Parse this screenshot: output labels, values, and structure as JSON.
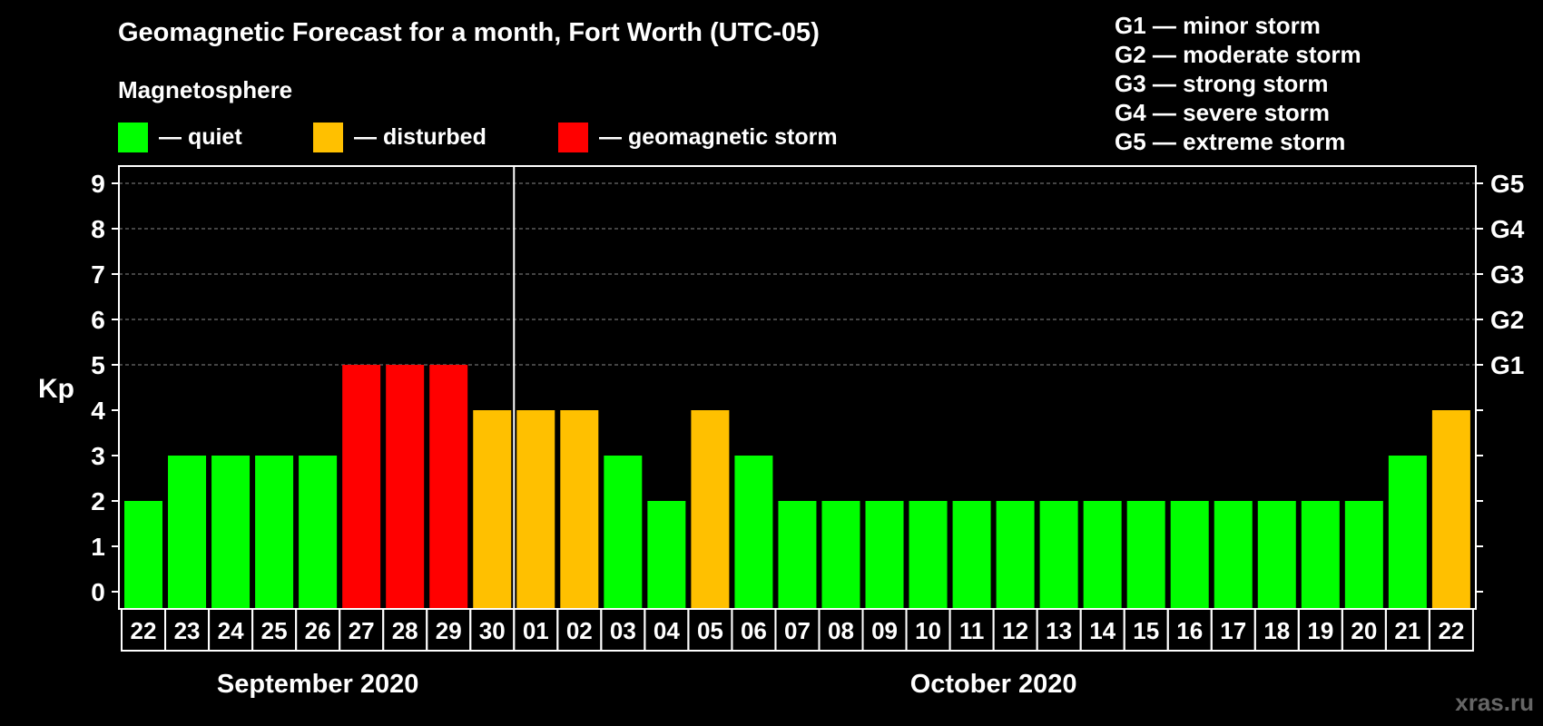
{
  "title": "Geomagnetic Forecast for a month, Fort Worth (UTC-05)",
  "subtitle": "Magnetosphere",
  "legend": [
    {
      "label": "— quiet",
      "color": "#00ff00"
    },
    {
      "label": "— disturbed",
      "color": "#ffc000"
    },
    {
      "label": "— geomagnetic storm",
      "color": "#ff0000"
    }
  ],
  "storm_legend": [
    "G1 — minor storm",
    "G2 — moderate storm",
    "G3 — strong storm",
    "G4 — severe storm",
    "G5 — extreme storm"
  ],
  "watermark": "xras.ru",
  "chart_data": {
    "type": "bar",
    "ylabel": "Kp",
    "ylim": [
      0,
      9
    ],
    "yticks": [
      0,
      1,
      2,
      3,
      4,
      5,
      6,
      7,
      8,
      9
    ],
    "right_axis_labels": [
      {
        "kp": 5,
        "label": "G1"
      },
      {
        "kp": 6,
        "label": "G2"
      },
      {
        "kp": 7,
        "label": "G3"
      },
      {
        "kp": 8,
        "label": "G4"
      },
      {
        "kp": 9,
        "label": "G5"
      }
    ],
    "grid": "dashed horizontal lines at Kp 5–9",
    "categories": [
      "22",
      "23",
      "24",
      "25",
      "26",
      "27",
      "28",
      "29",
      "30",
      "01",
      "02",
      "03",
      "04",
      "05",
      "06",
      "07",
      "08",
      "09",
      "10",
      "11",
      "12",
      "13",
      "14",
      "15",
      "16",
      "17",
      "18",
      "19",
      "20",
      "21",
      "22"
    ],
    "values": [
      2,
      3,
      3,
      3,
      3,
      5,
      5,
      5,
      4,
      4,
      4,
      3,
      2,
      4,
      3,
      2,
      2,
      2,
      2,
      2,
      2,
      2,
      2,
      2,
      2,
      2,
      2,
      2,
      2,
      3,
      4
    ],
    "color_rule": {
      "quiet": "#00ff00",
      "disturbed": "#ffc000",
      "storm": "#ff0000"
    },
    "month_groups": [
      {
        "label": "September 2020",
        "count": 9
      },
      {
        "label": "October 2020",
        "count": 22
      }
    ]
  }
}
